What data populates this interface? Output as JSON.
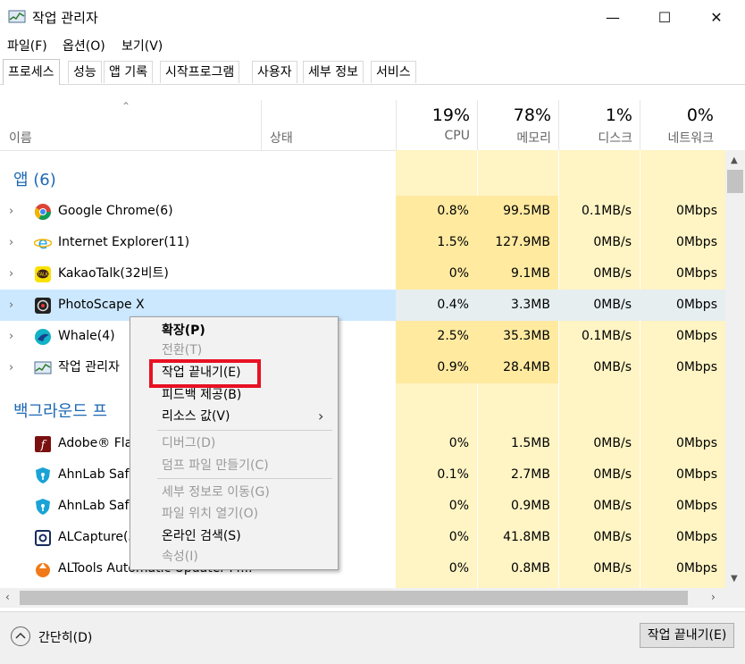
{
  "window": {
    "title": "작업 관리자",
    "minimize": "—",
    "maximize": "☐",
    "close": "✕"
  },
  "menu": [
    "파일(F)",
    "옵션(O)",
    "보기(V)"
  ],
  "tabs": [
    "프로세스",
    "성능",
    "앱 기록",
    "시작프로그램",
    "사용자",
    "세부 정보",
    "서비스"
  ],
  "columns": {
    "name": "이름",
    "status": "상태",
    "cpu": {
      "pct": "19%",
      "label": "CPU"
    },
    "mem": {
      "pct": "78%",
      "label": "메모리"
    },
    "disk": {
      "pct": "1%",
      "label": "디스크"
    },
    "net": {
      "pct": "0%",
      "label": "네트워크"
    }
  },
  "groups": {
    "apps": "앱 (6)",
    "background": "백그라운드 프"
  },
  "apps": [
    {
      "name": "Google Chrome(6)",
      "cpu": "0.8%",
      "mem": "99.5MB",
      "disk": "0.1MB/s",
      "net": "0Mbps",
      "icon": "chrome-icon"
    },
    {
      "name": "Internet Explorer(11)",
      "cpu": "1.5%",
      "mem": "127.9MB",
      "disk": "0MB/s",
      "net": "0Mbps",
      "icon": "ie-icon"
    },
    {
      "name": "KakaoTalk(32비트)",
      "cpu": "0%",
      "mem": "9.1MB",
      "disk": "0MB/s",
      "net": "0Mbps",
      "icon": "kakaotalk-icon"
    },
    {
      "name": "PhotoScape X",
      "cpu": "0.4%",
      "mem": "3.3MB",
      "disk": "0MB/s",
      "net": "0Mbps",
      "icon": "photoscape-icon"
    },
    {
      "name": "Whale(4)",
      "cpu": "2.5%",
      "mem": "35.3MB",
      "disk": "0.1MB/s",
      "net": "0Mbps",
      "icon": "whale-icon"
    },
    {
      "name": "작업 관리자",
      "cpu": "0.9%",
      "mem": "28.4MB",
      "disk": "0MB/s",
      "net": "0Mbps",
      "icon": "taskmgr-icon"
    }
  ],
  "background": [
    {
      "name": "Adobe® Fla",
      "cpu": "0%",
      "mem": "1.5MB",
      "disk": "0MB/s",
      "net": "0Mbps",
      "icon": "flash-icon"
    },
    {
      "name": "AhnLab Saf",
      "cpu": "0.1%",
      "mem": "2.7MB",
      "disk": "0MB/s",
      "net": "0Mbps",
      "icon": "ahnlab-icon"
    },
    {
      "name": "AhnLab Saf",
      "cpu": "0%",
      "mem": "0.9MB",
      "disk": "0MB/s",
      "net": "0Mbps",
      "icon": "ahnlab-icon"
    },
    {
      "name": "ALCapture(3",
      "cpu": "0%",
      "mem": "41.8MB",
      "disk": "0MB/s",
      "net": "0Mbps",
      "icon": "alcapture-icon"
    },
    {
      "name": "ALTools Automatic Updater Pr...",
      "cpu": "0%",
      "mem": "0.8MB",
      "disk": "0MB/s",
      "net": "0Mbps",
      "icon": "altools-icon"
    }
  ],
  "context_menu": [
    {
      "label": "확장(P)",
      "bold": true
    },
    {
      "label": "전환(T)",
      "disabled": true
    },
    {
      "label": "작업 끝내기(E)",
      "highlight": true
    },
    {
      "label": "피드백 제공(B)"
    },
    {
      "label": "리소스 값(V)",
      "submenu": "›"
    },
    {
      "label": "디버그(D)",
      "disabled": true
    },
    {
      "label": "덤프 파일 만들기(C)",
      "disabled": true
    },
    {
      "label": "세부 정보로 이동(G)",
      "disabled": true
    },
    {
      "label": "파일 위치 열기(O)",
      "disabled": true
    },
    {
      "label": "온라인 검색(S)"
    },
    {
      "label": "속성(I)",
      "disabled": true
    }
  ],
  "footer": {
    "fewer": "간단히(D)",
    "end_task": "작업 끝내기(E)"
  },
  "colors": {
    "highlight_box": "#e81123",
    "selected_row": "#cce8ff",
    "group_text": "#1d68b5"
  }
}
